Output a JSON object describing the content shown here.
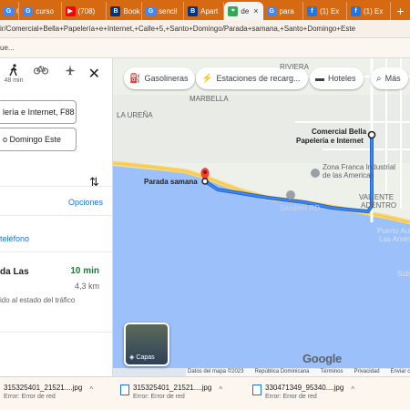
{
  "browser": {
    "tabs": [
      {
        "label": "G",
        "icon": "google-icon",
        "color": "#4285f4"
      },
      {
        "label": "curso",
        "icon": "google-icon",
        "color": "#4285f4"
      },
      {
        "label": "(708)",
        "icon": "youtube-icon",
        "color": "#ff0000"
      },
      {
        "label": "Book",
        "icon": "booking-icon",
        "color": "#003580"
      },
      {
        "label": "sencil",
        "icon": "google-icon",
        "color": "#4285f4"
      },
      {
        "label": "Apart",
        "icon": "booking-icon",
        "color": "#003580"
      },
      {
        "label": "de",
        "icon": "maps-icon",
        "color": "#34a853",
        "active": true
      },
      {
        "label": "para",
        "icon": "google-icon",
        "color": "#4285f4"
      },
      {
        "label": "(1) Ex",
        "icon": "facebook-icon",
        "color": "#1877f2"
      },
      {
        "label": "(1) Ex",
        "icon": "facebook-icon",
        "color": "#1877f2"
      }
    ],
    "new_tab": "+",
    "address": "ir/Comercial+Bella+Papelería+e+Internet,+Calle+5,+Santo+Domingo/Parada+samana,+Santo+Domingo+Este",
    "bookmarks_text": "ue..."
  },
  "directions": {
    "modes": [
      {
        "name": "walking-icon",
        "sub": "48 min"
      },
      {
        "name": "bicycle-icon",
        "sub": ""
      },
      {
        "name": "flight-icon",
        "sub": ""
      }
    ],
    "origin": "lería e Internet, F88",
    "destination": "o Domingo Este",
    "options_label": "Opciones",
    "phone_label": " teléfono",
    "route": {
      "name": "da Las",
      "time": "10 min",
      "distance": "4,3 km",
      "note": "ido al estado del tráfico"
    }
  },
  "map": {
    "chips": [
      {
        "icon": "gas-station-icon",
        "label": "Gasolineras"
      },
      {
        "icon": "charging-station-icon",
        "label": "Estaciones de recarg..."
      },
      {
        "icon": "hotel-icon",
        "label": "Hoteles"
      },
      {
        "icon": "more-icon",
        "label": "Más"
      }
    ],
    "labels": {
      "riviera": "RIVIERA",
      "marbella": "MARBELLA",
      "la_urena": "LA UREÑA",
      "comercial_1": "Comercial Bella",
      "comercial_2": "Papelería e Internet",
      "zona_1": "Zona Franca Industrial",
      "zona_2": "de las Americas",
      "parada": "Parada samana",
      "valiente_1": "VALIENTE",
      "valiente_2": "ADENTRO",
      "sendero": "Sendero RD",
      "aeropuerto_1": "Puerto Aut",
      "aeropuerto_2": "Las Amér",
      "sub": "Sub"
    },
    "layers_label": "Capas",
    "google": "Google",
    "attribution": [
      "Datos del mapa ©2023",
      "República Dominicana",
      "Términos",
      "Privacidad",
      "Enviar co"
    ]
  },
  "downloads": [
    {
      "name": "315325401_21521....jpg",
      "status": "Error: Error de red"
    },
    {
      "name": "315325401_21521....jpg",
      "status": "Error: Error de red"
    },
    {
      "name": "330471349_95340....jpg",
      "status": "Error: Error de red"
    }
  ]
}
